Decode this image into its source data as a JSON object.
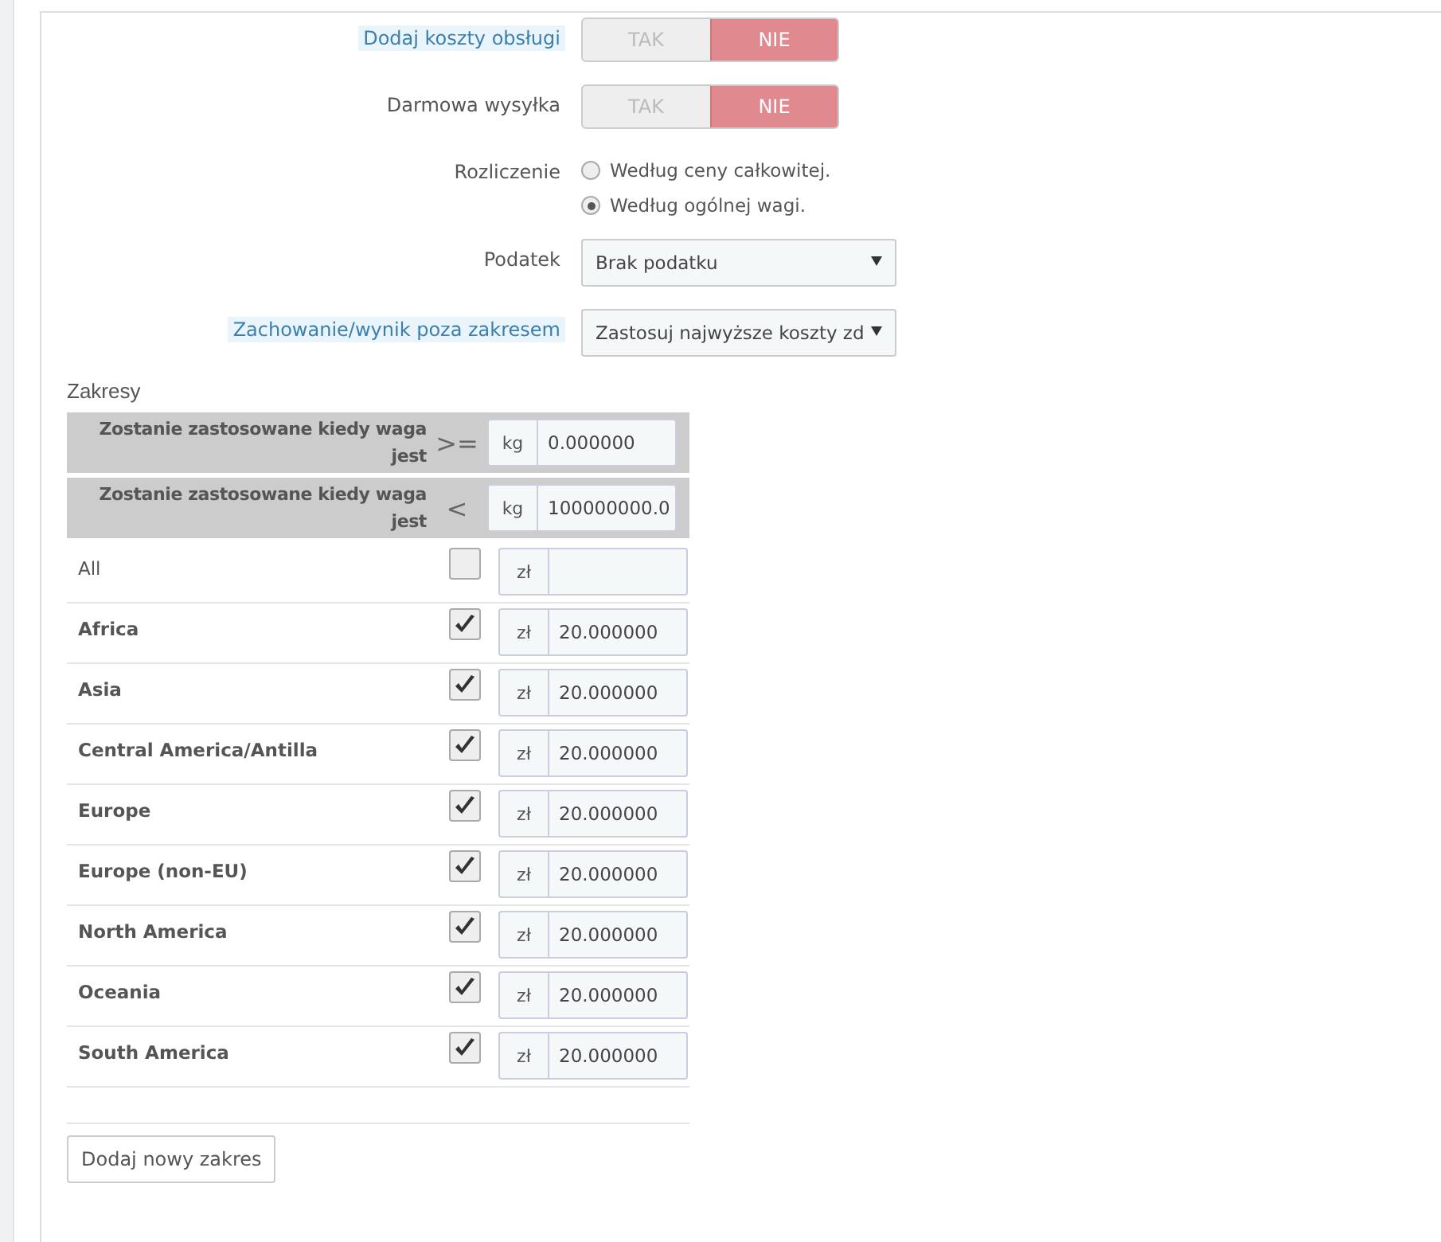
{
  "settings": [
    {
      "kind": "toggle",
      "label": "Dodaj koszty obsługi",
      "help": true,
      "options": [
        {
          "label": "TAK",
          "selected": false
        },
        {
          "label": "NIE",
          "selected": true
        }
      ]
    },
    {
      "kind": "toggle",
      "label": "Darmowa wysyłka",
      "help": false,
      "options": [
        {
          "label": "TAK",
          "selected": false
        },
        {
          "label": "NIE",
          "selected": true
        }
      ]
    },
    {
      "kind": "radio",
      "label": "Rozliczenie",
      "help": false,
      "options": [
        {
          "label": "Według ceny całkowitej.",
          "selected": false
        },
        {
          "label": "Według ogólnej wagi.",
          "selected": true
        }
      ]
    },
    {
      "kind": "select",
      "label": "Podatek",
      "help": false,
      "value": "Brak podatku"
    },
    {
      "kind": "select",
      "label": "Zachowanie/wynik poza zakresem",
      "help": true,
      "value": "Zastosuj najwyższe koszty zd"
    }
  ],
  "ranges": {
    "title": "Zakresy",
    "limits": [
      {
        "label": "Zostanie zastosowane kiedy waga jest",
        "operator": ">=",
        "unit": "kg",
        "value": "0.000000"
      },
      {
        "label": "Zostanie zastosowane kiedy waga jest",
        "operator": "<",
        "unit": "kg",
        "value": "100000000.0"
      }
    ],
    "zones": [
      {
        "name": "All",
        "bold": false,
        "checked": false,
        "unit": "zł"
      },
      {
        "name": "Africa",
        "bold": true,
        "checked": true,
        "unit": "zł",
        "value": "20.000000"
      },
      {
        "name": "Asia",
        "bold": true,
        "checked": true,
        "unit": "zł",
        "value": "20.000000"
      },
      {
        "name": "Central America/Antilla",
        "bold": true,
        "checked": true,
        "unit": "zł",
        "value": "20.000000"
      },
      {
        "name": "Europe",
        "bold": true,
        "checked": true,
        "unit": "zł",
        "value": "20.000000"
      },
      {
        "name": "Europe (non-EU)",
        "bold": true,
        "checked": true,
        "unit": "zł",
        "value": "20.000000"
      },
      {
        "name": "North America",
        "bold": true,
        "checked": true,
        "unit": "zł",
        "value": "20.000000"
      },
      {
        "name": "Oceania",
        "bold": true,
        "checked": true,
        "unit": "zł",
        "value": "20.000000"
      },
      {
        "name": "South America",
        "bold": true,
        "checked": true,
        "unit": "zł",
        "value": "20.000000"
      }
    ],
    "add_button": "Dodaj nowy zakres"
  }
}
